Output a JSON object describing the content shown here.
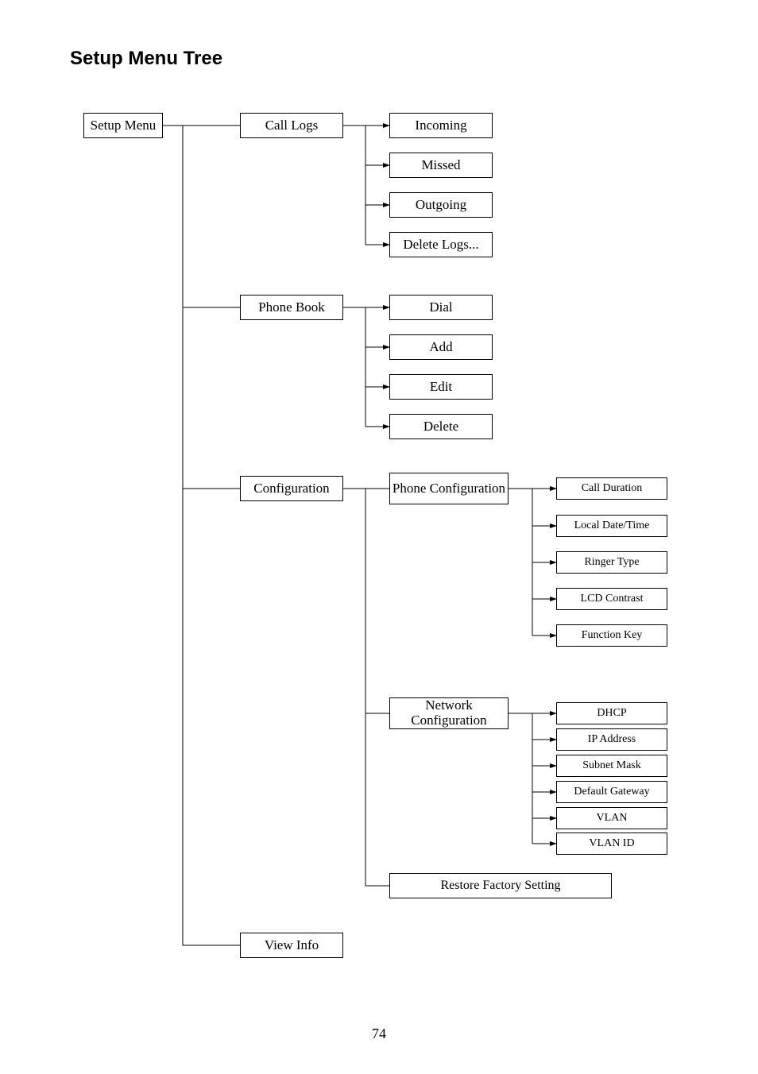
{
  "title": "Setup Menu Tree",
  "page_number": "74",
  "root": "Setup Menu",
  "level1": {
    "call_logs": "Call Logs",
    "phone_book": "Phone Book",
    "configuration": "Configuration",
    "view_info": "View Info"
  },
  "call_logs_children": {
    "incoming": "Incoming",
    "missed": "Missed",
    "outgoing": "Outgoing",
    "delete_logs": "Delete Logs..."
  },
  "phone_book_children": {
    "dial": "Dial",
    "add": "Add",
    "edit": "Edit",
    "delete": "Delete"
  },
  "configuration_children": {
    "phone_config": "Phone Configuration",
    "network_config": "Network Configuration",
    "restore": "Restore Factory Setting"
  },
  "phone_config_children": {
    "call_duration": "Call Duration",
    "local_datetime": "Local Date/Time",
    "ringer_type": "Ringer Type",
    "lcd_contrast": "LCD Contrast",
    "function_key": "Function Key"
  },
  "network_config_children": {
    "dhcp": "DHCP",
    "ip_address": "IP Address",
    "subnet_mask": "Subnet Mask",
    "default_gateway": "Default Gateway",
    "vlan": "VLAN",
    "vlan_id": "VLAN ID"
  }
}
